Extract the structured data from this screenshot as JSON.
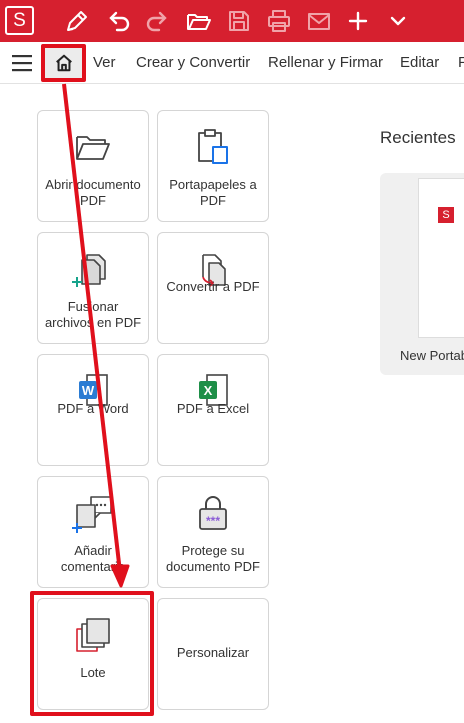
{
  "app": {
    "logo_letter": "S"
  },
  "toolbar": {
    "icons": [
      "pen-icon",
      "undo-icon",
      "redo-icon",
      "open-folder-icon",
      "save-icon",
      "print-icon",
      "mail-icon",
      "plus-icon",
      "chevron-down-icon"
    ]
  },
  "menubar": {
    "items": [
      {
        "label": "Ver"
      },
      {
        "label": "Crear y Convertir"
      },
      {
        "label": "Rellenar y Firmar"
      },
      {
        "label": "Editar"
      },
      {
        "label": "F"
      }
    ]
  },
  "tiles": {
    "abrir": "Abrir documento PDF",
    "portapapeles": "Portapapeles a PDF",
    "fusionar": "Fusionar archivos en PDF",
    "convertir": "Convertir a PDF",
    "word": "PDF a Word",
    "excel": "PDF a Excel",
    "comentario": "Añadir comentario",
    "protege": "Protege su documento PDF",
    "lote": "Lote",
    "personalizar": "Personalizar"
  },
  "recientes": {
    "title": "Recientes",
    "file_name": "New Portab",
    "thumb_logo": "S"
  },
  "colors": {
    "brand_red": "#d6202f",
    "annotation_red": "#e0101c",
    "word_blue": "#2b7cd3",
    "excel_green": "#1e8f48",
    "accent_blue": "#1a73e8",
    "accent_teal": "#17a38b",
    "accent_purple": "#8a5bd6"
  }
}
